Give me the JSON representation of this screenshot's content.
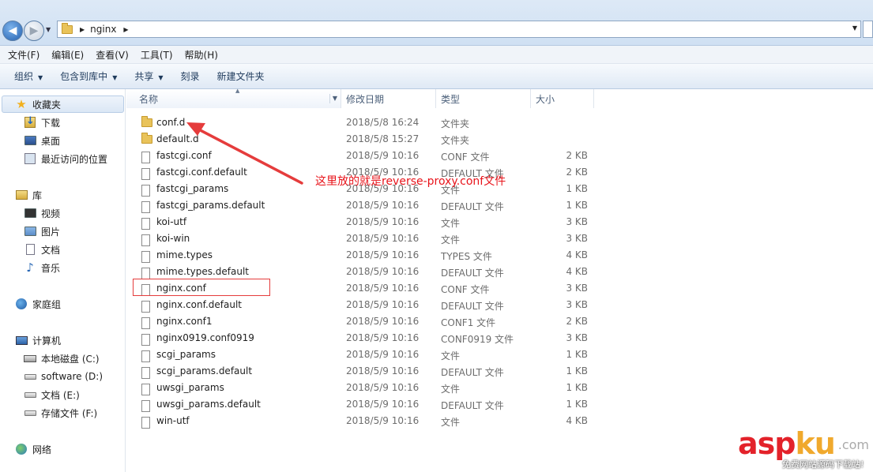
{
  "address": {
    "path": "nginx"
  },
  "menu": [
    "文件(F)",
    "编辑(E)",
    "查看(V)",
    "工具(T)",
    "帮助(H)"
  ],
  "toolbar": {
    "organize": "组织",
    "include_library": "包含到库中",
    "share": "共享",
    "burn": "刻录",
    "new_folder": "新建文件夹"
  },
  "sidebar": {
    "favorites": "收藏夹",
    "downloads": "下载",
    "desktop": "桌面",
    "recent": "最近访问的位置",
    "libraries": "库",
    "videos": "视频",
    "pictures": "图片",
    "documents": "文档",
    "music": "音乐",
    "homegroup": "家庭组",
    "computer": "计算机",
    "drive_c": "本地磁盘 (C:)",
    "drive_d": "software (D:)",
    "drive_e": "文档 (E:)",
    "drive_f": "存储文件 (F:)",
    "network": "网络"
  },
  "columns": {
    "name": "名称",
    "date": "修改日期",
    "type": "类型",
    "size": "大小"
  },
  "files": [
    {
      "name": "conf.d",
      "date": "2018/5/8 16:24",
      "type": "文件夹",
      "size": "",
      "folder": true
    },
    {
      "name": "default.d",
      "date": "2018/5/8 15:27",
      "type": "文件夹",
      "size": "",
      "folder": true
    },
    {
      "name": "fastcgi.conf",
      "date": "2018/5/9 10:16",
      "type": "CONF 文件",
      "size": "2 KB"
    },
    {
      "name": "fastcgi.conf.default",
      "date": "2018/5/9 10:16",
      "type": "DEFAULT 文件",
      "size": "2 KB"
    },
    {
      "name": "fastcgi_params",
      "date": "2018/5/9 10:16",
      "type": "文件",
      "size": "1 KB"
    },
    {
      "name": "fastcgi_params.default",
      "date": "2018/5/9 10:16",
      "type": "DEFAULT 文件",
      "size": "1 KB"
    },
    {
      "name": "koi-utf",
      "date": "2018/5/9 10:16",
      "type": "文件",
      "size": "3 KB"
    },
    {
      "name": "koi-win",
      "date": "2018/5/9 10:16",
      "type": "文件",
      "size": "3 KB"
    },
    {
      "name": "mime.types",
      "date": "2018/5/9 10:16",
      "type": "TYPES 文件",
      "size": "4 KB"
    },
    {
      "name": "mime.types.default",
      "date": "2018/5/9 10:16",
      "type": "DEFAULT 文件",
      "size": "4 KB"
    },
    {
      "name": "nginx.conf",
      "date": "2018/5/9 10:16",
      "type": "CONF 文件",
      "size": "3 KB"
    },
    {
      "name": "nginx.conf.default",
      "date": "2018/5/9 10:16",
      "type": "DEFAULT 文件",
      "size": "3 KB"
    },
    {
      "name": "nginx.conf1",
      "date": "2018/5/9 10:16",
      "type": "CONF1 文件",
      "size": "2 KB"
    },
    {
      "name": "nginx0919.conf0919",
      "date": "2018/5/9 10:16",
      "type": "CONF0919 文件",
      "size": "3 KB"
    },
    {
      "name": "scgi_params",
      "date": "2018/5/9 10:16",
      "type": "文件",
      "size": "1 KB"
    },
    {
      "name": "scgi_params.default",
      "date": "2018/5/9 10:16",
      "type": "DEFAULT 文件",
      "size": "1 KB"
    },
    {
      "name": "uwsgi_params",
      "date": "2018/5/9 10:16",
      "type": "文件",
      "size": "1 KB"
    },
    {
      "name": "uwsgi_params.default",
      "date": "2018/5/9 10:16",
      "type": "DEFAULT 文件",
      "size": "1 KB"
    },
    {
      "name": "win-utf",
      "date": "2018/5/9 10:16",
      "type": "文件",
      "size": "4 KB"
    }
  ],
  "annotation": {
    "text": "这里放的就是reverse-proxy.conf文件",
    "color": "#e8131a"
  },
  "watermark": {
    "logo_a": "asp",
    "logo_k": "ku",
    "dotcom": ".com",
    "sub": "免费网站源码下载站!"
  }
}
